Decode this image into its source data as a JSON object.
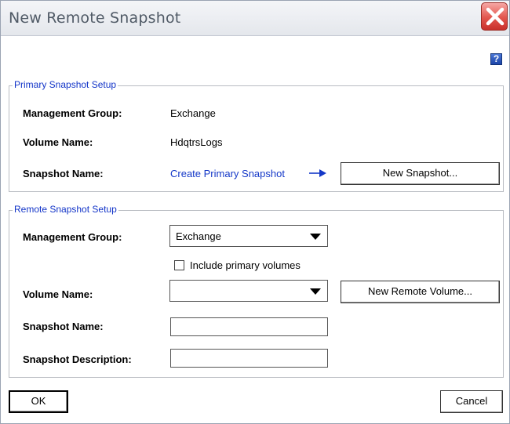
{
  "window": {
    "title": "New Remote Snapshot",
    "help_label": "?"
  },
  "primary": {
    "legend": "Primary Snapshot Setup",
    "mgmt_group_label": "Management Group:",
    "mgmt_group_value": "Exchange",
    "volume_label": "Volume Name:",
    "volume_value": "HdqtrsLogs",
    "snapshot_label": "Snapshot Name:",
    "create_link": "Create Primary Snapshot",
    "new_snapshot_button": "New Snapshot..."
  },
  "remote": {
    "legend": "Remote Snapshot Setup",
    "mgmt_group_label": "Management Group:",
    "mgmt_group_selected": "Exchange",
    "include_primary_label": "Include primary volumes",
    "include_primary_checked": false,
    "volume_label": "Volume Name:",
    "volume_selected": "",
    "new_remote_volume_button": "New Remote Volume...",
    "snapshot_name_label": "Snapshot Name:",
    "snapshot_name_value": "",
    "snapshot_desc_label": "Snapshot Description:",
    "snapshot_desc_value": ""
  },
  "footer": {
    "ok_label": "OK",
    "cancel_label": "Cancel"
  },
  "colors": {
    "legend_text": "#1234c8",
    "link_text": "#1438c8",
    "close_button": "#e2554d",
    "help_button": "#1c44a8"
  }
}
